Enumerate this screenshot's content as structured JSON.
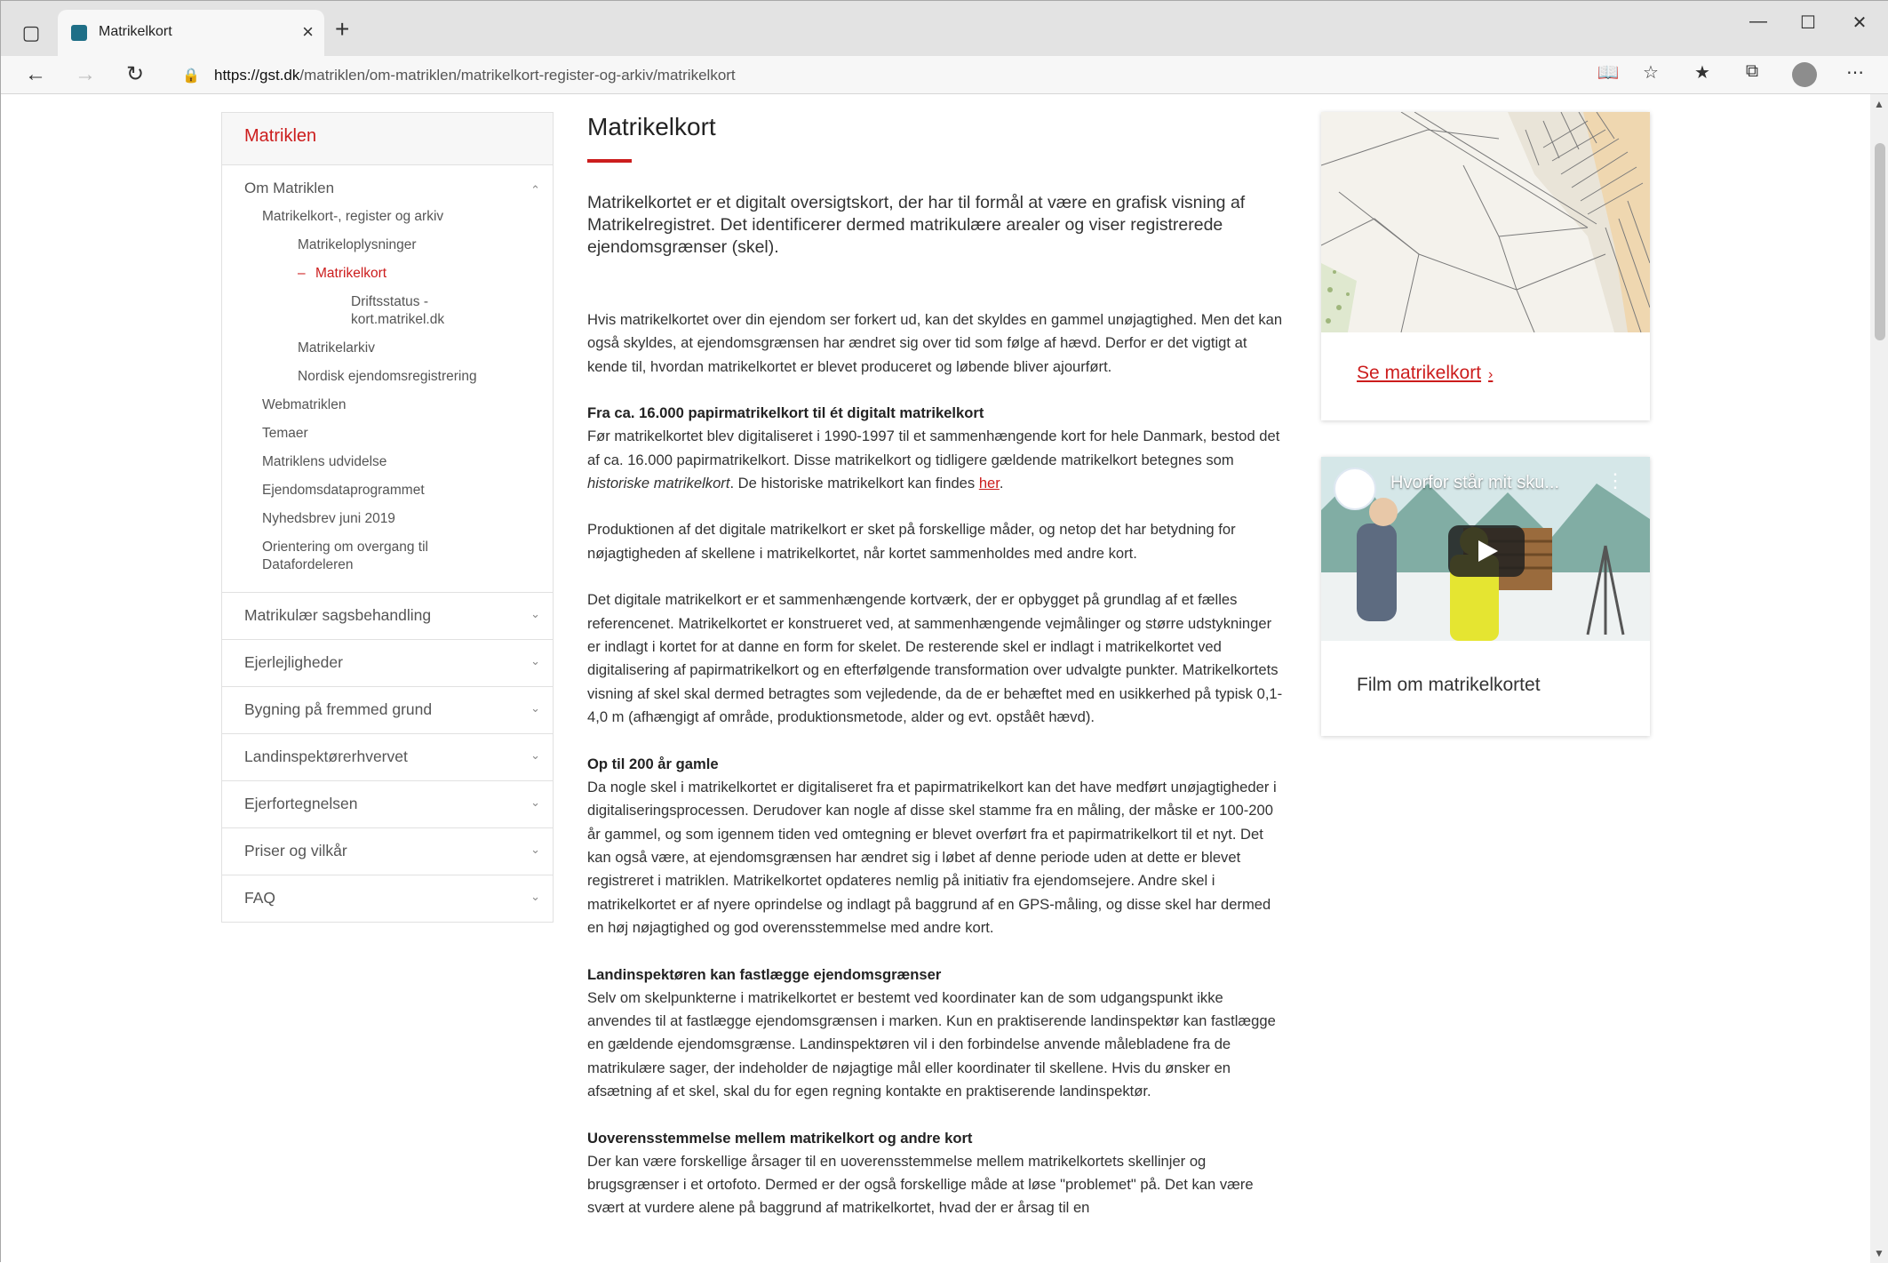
{
  "browser": {
    "tab_title": "Matrikelkort",
    "url_domain": "https://gst.dk",
    "url_path": "/matriklen/om-matriklen/matrikelkort-register-og-arkiv/matrikelkort",
    "icons": [
      "tab-actions-icon",
      "favicon-icon",
      "close-icon",
      "plus-icon",
      "minimize-icon",
      "maximize-icon",
      "close-window-icon",
      "back-icon",
      "forward-icon",
      "refresh-icon",
      "lock-icon",
      "reader-mode-icon",
      "add-favorite-icon",
      "favorites-icon",
      "collections-icon",
      "profile-icon",
      "more-icon"
    ]
  },
  "sidebar": {
    "heading": "Matriklen",
    "open_section": "Om Matriklen",
    "items": [
      {
        "label": "Matrikelkort-, register og arkiv",
        "level": 2
      },
      {
        "label": "Matrikeloplysninger",
        "level": 3
      },
      {
        "label": "Matrikelkort",
        "level": 3,
        "active": true
      },
      {
        "label": "Driftsstatus - kort.matrikel.dk",
        "level": 4
      },
      {
        "label": "Matrikelarkiv",
        "level": 3
      },
      {
        "label": "Nordisk ejendomsregistrering",
        "level": 3
      },
      {
        "label": "Webmatriklen",
        "level": 2
      },
      {
        "label": "Temaer",
        "level": 2
      },
      {
        "label": "Matriklens udvidelse",
        "level": 2
      },
      {
        "label": "Ejendomsdataprogrammet",
        "level": 2
      },
      {
        "label": "Nyhedsbrev juni 2019",
        "level": 2
      },
      {
        "label": "Orientering om overgang til Datafordeleren",
        "level": 2
      }
    ],
    "sections": [
      "Matrikulær sagsbehandling",
      "Ejerlejligheder",
      "Bygning på fremmed grund",
      "Landinspektørerhvervet",
      "Ejerfortegnelsen",
      "Priser og vilkår",
      "FAQ"
    ]
  },
  "main": {
    "title": "Matrikelkort",
    "lead": "Matrikelkortet er et digitalt oversigtskort, der har til formål at være en grafisk visning af Matrikelregistret. Det identificerer dermed matrikulære arealer og viser registrerede ejendomsgrænser (skel).",
    "p1": "Hvis matrikelkortet over din ejendom ser forkert ud, kan det skyldes en gammel unøjagtighed. Men det kan også skyldes, at ejendomsgrænsen har ændret sig over tid som følge af hævd. Derfor er det vigtigt at kende til, hvordan matrikelkortet er blevet produceret og løbende bliver ajourført.",
    "s1_heading": "Fra ca. 16.000 papirmatrikelkort til ét digitalt matrikelkort",
    "s1_text_a": "Før matrikelkortet blev digitaliseret i 1990-1997 til et sammenhængende kort for hele Danmark, bestod det af ca. 16.000 papirmatrikelkort. Disse matrikelkort og tidligere gældende matrikelkort betegnes som ",
    "s1_text_em": "historiske matrikelkort",
    "s1_text_b": ". De historiske matrikelkort kan findes ",
    "s1_link": "her",
    "s1_text_c": ".",
    "p2": "Produktionen af det digitale matrikelkort er sket på forskellige måder, og netop det har betydning for nøjagtigheden af skellene i matrikelkortet, når kortet sammenholdes med andre kort.",
    "p3": "Det digitale matrikelkort er et sammenhængende kortværk, der er opbygget på grundlag af et fælles referencenet. Matrikelkortet er konstrueret ved, at sammenhængende vejmålinger og større udstykninger er indlagt i kortet for at danne en form for skelet. De resterende skel er indlagt i matrikelkortet ved digitalisering af papirmatrikelkort og en efterfølgende transformation over udvalgte punkter. Matrikelkortets visning af skel skal dermed betragtes som vejledende, da de er behæftet med en usikkerhed på typisk 0,1-4,0 m (afhængigt af område, produktionsmetode, alder og evt. opståêt hævd).",
    "s2_heading": "Op til 200 år gamle",
    "s2_text": "Da nogle skel i matrikelkortet er digitaliseret fra et papirmatrikelkort kan det have medført unøjagtigheder i digitaliseringsprocessen. Derudover kan nogle af disse skel stamme fra en måling, der måske er 100-200 år gammel, og som igennem tiden ved omtegning er blevet overført fra et papirmatrikelkort til et nyt. Det kan også være, at ejendomsgrænsen har ændret sig i løbet af denne periode uden at dette er blevet registreret i matriklen. Matrikelkortet opdateres nemlig på initiativ fra ejendomsejere. Andre skel i matrikelkortet er af nyere oprindelse og indlagt på baggrund af en GPS-måling, og disse skel har dermed en høj nøjagtighed og god overensstemmelse med andre kort.",
    "s3_heading": "Landinspektøren kan fastlægge ejendomsgrænser",
    "s3_text": "Selv om skelpunkterne i matrikelkortet er bestemt ved koordinater kan de som udgangspunkt ikke anvendes til at fastlægge ejendomsgrænsen i marken. Kun en praktiserende landinspektør kan fastlægge en gældende ejendomsgrænse. Landinspektøren vil i den forbindelse anvende målebladene fra de matrikulære sager, der indeholder de nøjagtige mål eller koordinater til skellene. Hvis du ønsker en afsætning af et skel, skal du for egen regning kontakte en praktiserende landinspektør.",
    "s4_heading": "Uoverensstemmelse mellem matrikelkort og andre kort",
    "s4_text": "Der kan være forskellige årsager til en uoverensstemmelse mellem matrikelkortets skellinjer og brugsgrænser i et ortofoto. Dermed er der også forskellige måde at løse \"problemet\" på. Det kan være svært at vurdere alene på baggrund af matrikelkortet, hvad der er årsag til en"
  },
  "aside": {
    "card1_link": "Se matrikelkort",
    "video_title": "Hvorfor står mit sku...",
    "card2_title": "Film om matrikelkortet"
  }
}
